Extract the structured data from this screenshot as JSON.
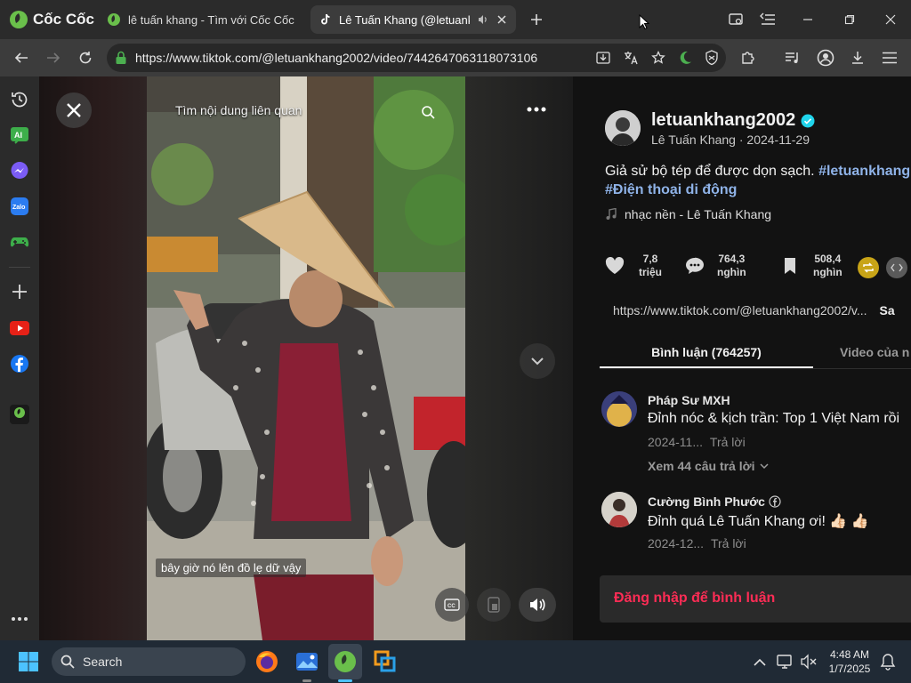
{
  "browser": {
    "brand": "Cốc Cốc",
    "tabs": [
      {
        "title": "lê tuấn khang - Tìm với Cốc Cốc",
        "icon": "coccoc-search-icon",
        "active": false
      },
      {
        "title": "Lê Tuấn Khang (@letuank",
        "icon": "tiktok-icon",
        "active": true
      }
    ],
    "url": "https://www.tiktok.com/@letuankhang2002/video/7442647063118073106",
    "accent": "#4caf50"
  },
  "video": {
    "related_label": "Tìm nội dung liên quan",
    "caption": "bây giờ nó lên đồ lẹ dữ vậy"
  },
  "post": {
    "username": "letuankhang2002",
    "display_name_date": "Lê Tuấn Khang · 2024-11-29",
    "description_text": "Giả sử bộ tép để được dọn sạch.",
    "hashtag1": "#letuankhang",
    "hashtag2": "#Điện thoại di động",
    "music": "nhạc nền - Lê Tuấn Khang",
    "likes_num": "7,8",
    "likes_unit": "triệu",
    "comments_num": "764,3",
    "comments_unit": "nghìn",
    "saves_num": "508,4",
    "saves_unit": "nghìn",
    "share_url": "https://www.tiktok.com/@letuankhang2002/v...",
    "copy_label": "Sa",
    "tab_comments": "Bình luận (764257)",
    "tab_videos": "Video của n"
  },
  "comments": [
    {
      "author": "Pháp Sư MXH",
      "text": "Đỉnh nóc & kịch trần: Top 1 Việt Nam rồi",
      "date": "2024-11...",
      "reply": "Trả lời",
      "view_replies": "Xem 44 câu trả lời"
    },
    {
      "author": "Cường Bình Phước",
      "text": "Đỉnh quá Lê Tuấn Khang ơi! 👍🏻 👍🏻",
      "date": "2024-12...",
      "reply": "Trả lời"
    }
  ],
  "login_prompt": "Đăng nhập để bình luận",
  "login_color": "#fe2c55",
  "taskbar": {
    "search_label": "Search",
    "time": "4:48 AM",
    "date": "1/7/2025"
  }
}
